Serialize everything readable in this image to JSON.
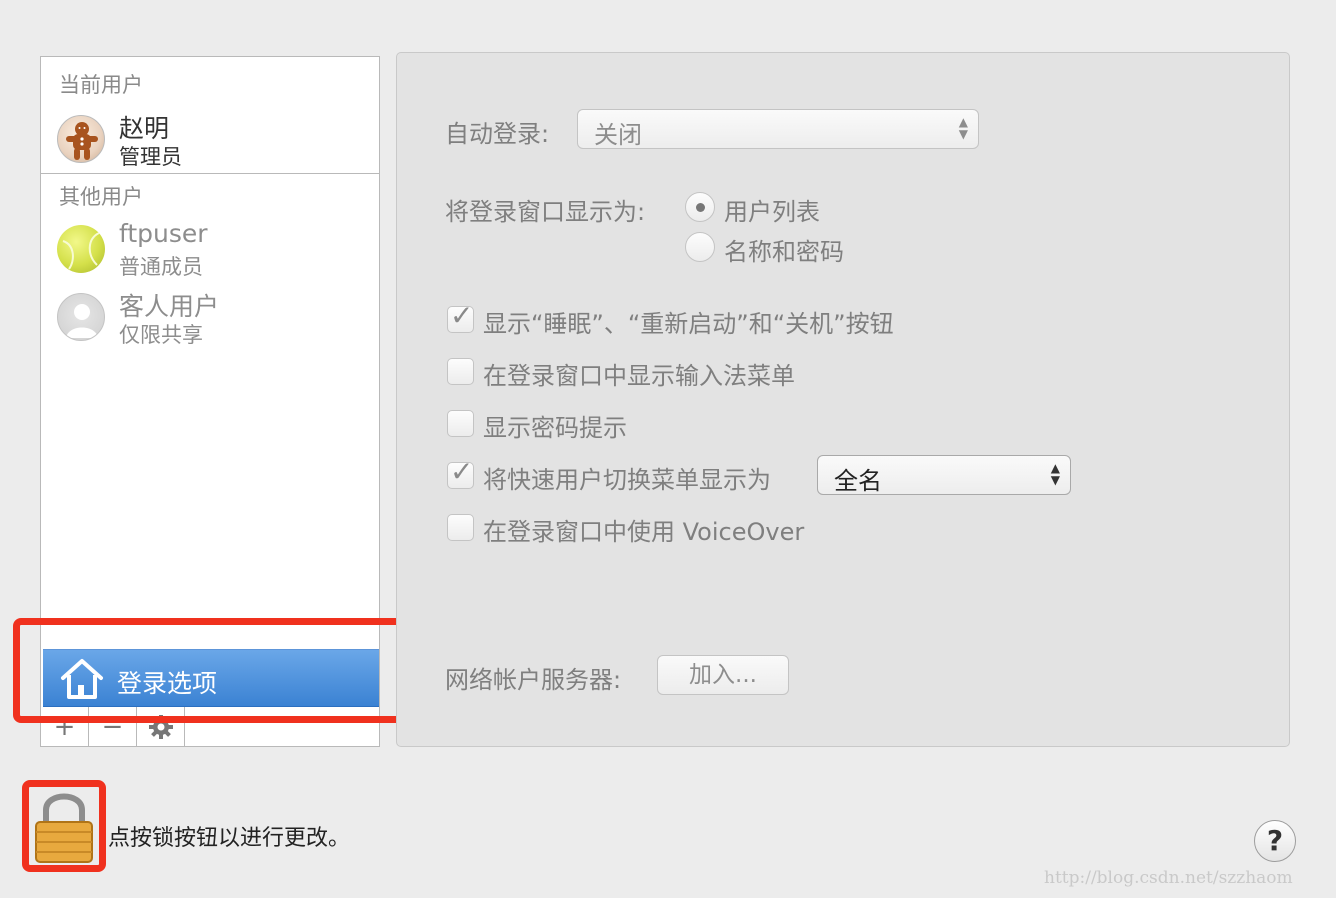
{
  "sidebar": {
    "current_users_title": "当前用户",
    "current_user": {
      "name": "赵明",
      "role": "管理员",
      "avatar_icon": "gingerbread-avatar-icon"
    },
    "other_users_title": "其他用户",
    "other_users": [
      {
        "name": "ftpuser",
        "role": "普通成员",
        "avatar_icon": "tennis-ball-avatar-icon"
      },
      {
        "name": "客人用户",
        "role": "仅限共享",
        "avatar_icon": "guest-avatar-icon"
      }
    ],
    "login_options": {
      "label": "登录选项",
      "icon": "house-icon"
    },
    "toolbar": {
      "add": "+",
      "remove": "−",
      "gear_icon": "gear-icon"
    }
  },
  "panel": {
    "auto_login": {
      "label": "自动登录:",
      "value": "关闭"
    },
    "display_login_window": {
      "label": "将登录窗口显示为:",
      "options": [
        {
          "label": "用户列表",
          "selected": true
        },
        {
          "label": "名称和密码",
          "selected": false
        }
      ]
    },
    "checkboxes": [
      {
        "label": "显示“睡眠”、“重新启动”和“关机”按钮",
        "checked": true
      },
      {
        "label": "在登录窗口中显示输入法菜单",
        "checked": false
      },
      {
        "label": "显示密码提示",
        "checked": false
      },
      {
        "label": "将快速用户切换菜单显示为",
        "checked": true
      },
      {
        "label": "在登录窗口中使用 VoiceOver",
        "checked": false
      }
    ],
    "fast_user_switch_value": "全名",
    "network_server": {
      "label": "网络帐户服务器:",
      "button": "加入..."
    }
  },
  "bottom": {
    "lock_text": "点按锁按钮以进行更改。",
    "help": "?",
    "watermark": "http://blog.csdn.net/szzhaom"
  },
  "colors": {
    "highlight": "#f0311e",
    "selection": "#3b82d3"
  }
}
